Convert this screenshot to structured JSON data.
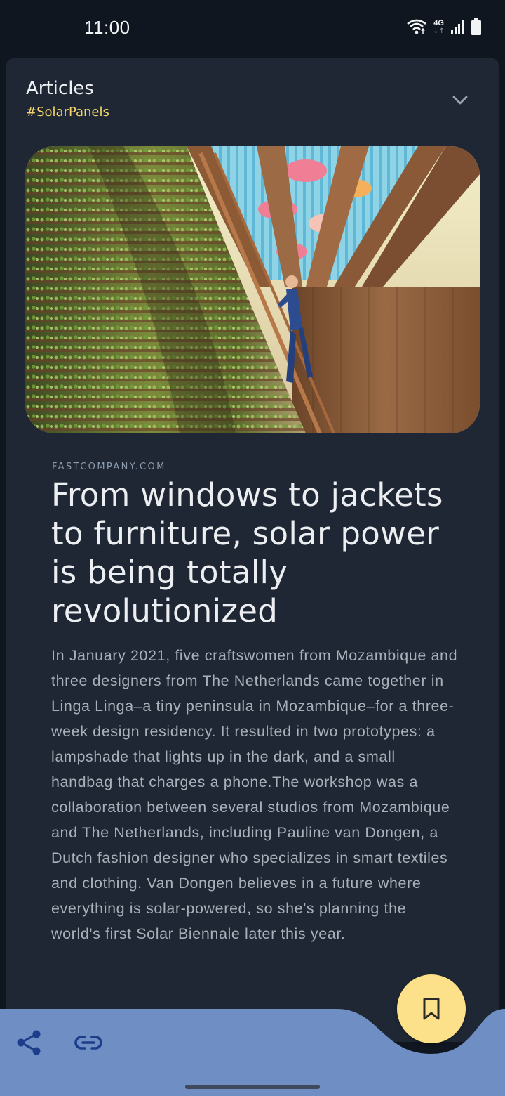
{
  "status": {
    "time": "11:00",
    "network": "4G",
    "icons": [
      "wifi-icon",
      "mobile-data-icon",
      "signal-icon",
      "battery-icon"
    ]
  },
  "card": {
    "title": "Articles",
    "tag": "#SolarPanels",
    "collapse_icon": "chevron-down-icon"
  },
  "article": {
    "source": "FASTCOMPANY.COM",
    "headline": "From windows to jackets to furniture, solar power is being totally revolutionized",
    "body": "In January 2021, five craftswomen from Mozambique and three designers from The Netherlands came together in Linga Linga–a tiny peninsula in Mozambique–for a three-week design residency. It resulted in two prototypes: a lampshade that lights up in the dark, and a small handbag that charges a phone.The workshop was a collaboration between several studios from Mozambique and The Netherlands, including Pauline van Dongen, a Dutch fashion designer who specializes in smart textiles and clothing. Van Dongen believes in a future where everything is solar-powered, so she's planning the world's first Solar Biennale later this year."
  },
  "bottom_bar": {
    "actions": [
      "share-icon",
      "link-icon"
    ],
    "fab_icon": "bookmark-icon"
  },
  "colors": {
    "background": "#0f1620",
    "card": "#1e2733",
    "accent_yellow": "#fde18a",
    "tag": "#f6d66b",
    "bottom_bar": "#6f8ec4",
    "icon_blue": "#1c3e8a"
  }
}
